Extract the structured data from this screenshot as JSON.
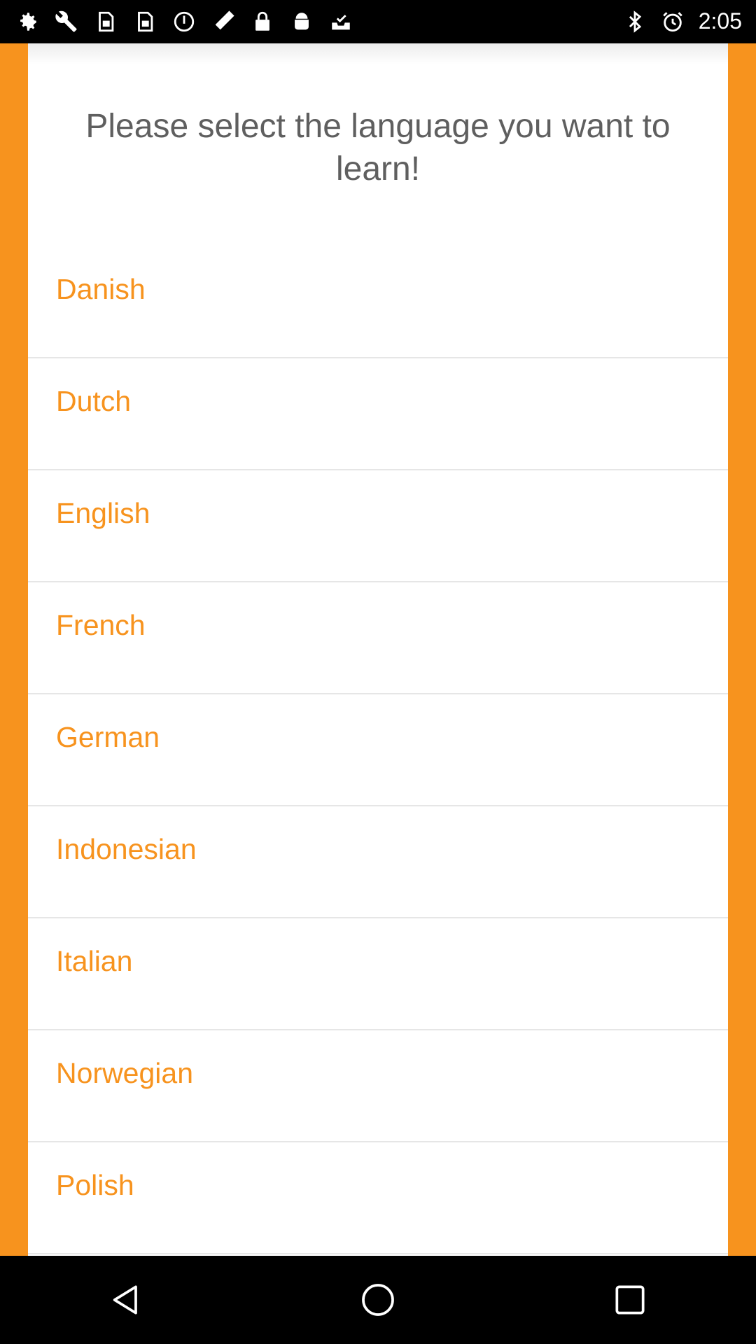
{
  "status_bar": {
    "time": "2:05",
    "icons": [
      "settings-icon",
      "wrench-icon",
      "sim-icon",
      "sim-icon",
      "circle-icon",
      "satellite-icon",
      "lock-icon",
      "android-icon",
      "check-inbox-icon",
      "bluetooth-icon",
      "alarm-icon"
    ]
  },
  "prompt": "Please select the language you want to learn!",
  "languages": [
    "Danish",
    "Dutch",
    "English",
    "French",
    "German",
    "Indonesian",
    "Italian",
    "Norwegian",
    "Polish"
  ],
  "colors": {
    "accent": "#f7931e",
    "text": "#5f5f5f"
  },
  "nav": {
    "icons": [
      "back-icon",
      "home-icon",
      "recents-icon"
    ]
  }
}
